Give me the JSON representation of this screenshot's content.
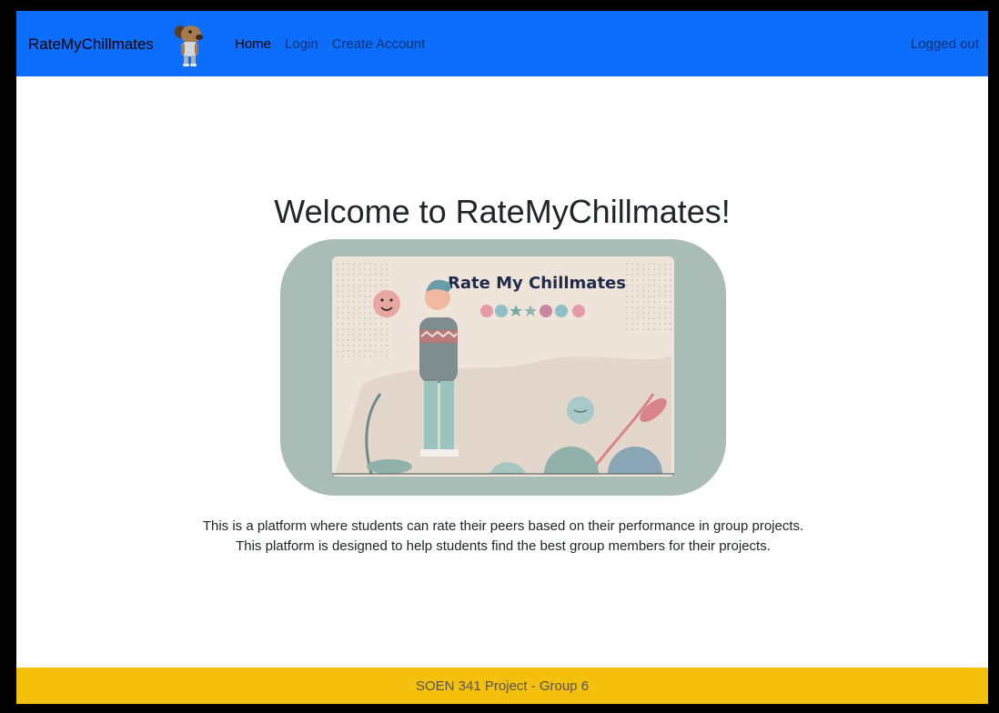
{
  "nav": {
    "brand": "RateMyChillmates",
    "links": [
      {
        "label": "Home",
        "active": true
      },
      {
        "label": "Login",
        "active": false
      },
      {
        "label": "Create Account",
        "active": false
      }
    ],
    "status": "Logged out"
  },
  "main": {
    "title": "Welcome to RateMyChillmates!",
    "image_text": "Rate My Chillmates",
    "description": "This is a platform where students can rate their peers based on their performance in group projects. This platform is designed to help students find the best group members for their projects."
  },
  "footer": {
    "text": "SOEN 341 Project - Group 6"
  },
  "colors": {
    "navbar": "#0d6efd",
    "footer": "#f5c00b"
  }
}
